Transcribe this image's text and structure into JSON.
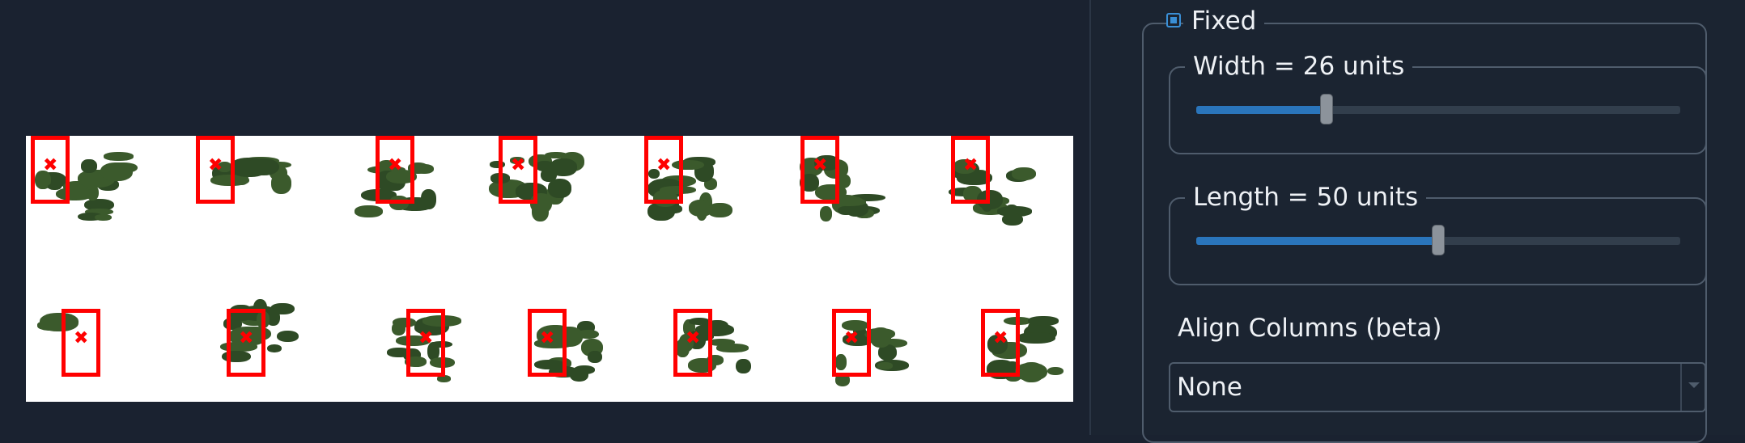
{
  "fixed": {
    "label": "Fixed",
    "checked": true
  },
  "width": {
    "label": "Width = 26 units",
    "value": 26,
    "fraction": 0.27
  },
  "length": {
    "label": "Length = 50 units",
    "value": 50,
    "fraction": 0.5
  },
  "align": {
    "label": "Align Columns (beta)",
    "selected": "None"
  },
  "plot": {
    "marker": "✖",
    "rows": 2,
    "columns": 7
  },
  "colors": {
    "accent": "#2a75bb",
    "box": "#ff0000",
    "vegetation": "#2e4a25"
  }
}
